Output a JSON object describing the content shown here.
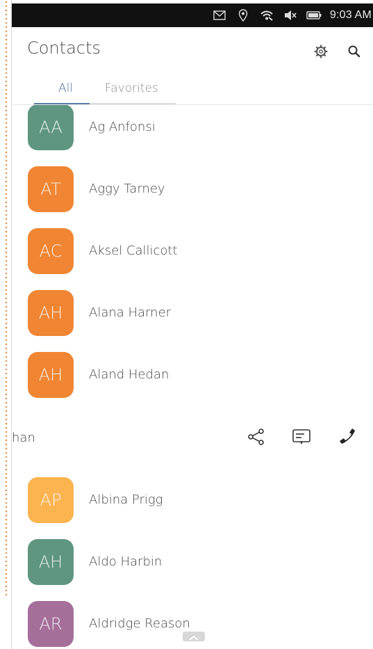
{
  "status_bar": {
    "time": "9:03 AM",
    "icons": [
      "mail-icon",
      "location-icon",
      "wifi-icon",
      "volume-muted-icon",
      "battery-icon"
    ]
  },
  "header": {
    "title": "Contacts",
    "settings_icon": "gear-icon",
    "search_icon": "search-icon"
  },
  "tabs": [
    {
      "label": "All",
      "active": true
    },
    {
      "label": "Favorites",
      "active": false
    }
  ],
  "contacts": [
    {
      "initials": "AA",
      "name": "Ag Anfonsi",
      "color": "#5f9681"
    },
    {
      "initials": "AT",
      "name": "Aggy Tarney",
      "color": "#f08633"
    },
    {
      "initials": "AC",
      "name": "Aksel Callicott",
      "color": "#f08633"
    },
    {
      "initials": "AH",
      "name": "Alana Harner",
      "color": "#f08633"
    },
    {
      "initials": "AH",
      "name": "Aland Hedan",
      "color": "#f08633"
    }
  ],
  "expanded_contact": {
    "name_fragment": "han",
    "actions": [
      {
        "name": "share-icon"
      },
      {
        "name": "message-icon"
      },
      {
        "name": "phone-icon"
      }
    ]
  },
  "contacts_after": [
    {
      "initials": "AP",
      "name": "Albina Prigg",
      "color": "#fbb450"
    },
    {
      "initials": "AH",
      "name": "Aldo Harbin",
      "color": "#5f9681"
    },
    {
      "initials": "AR",
      "name": "Aldridge Reason",
      "color": "#a56f9a"
    }
  ]
}
